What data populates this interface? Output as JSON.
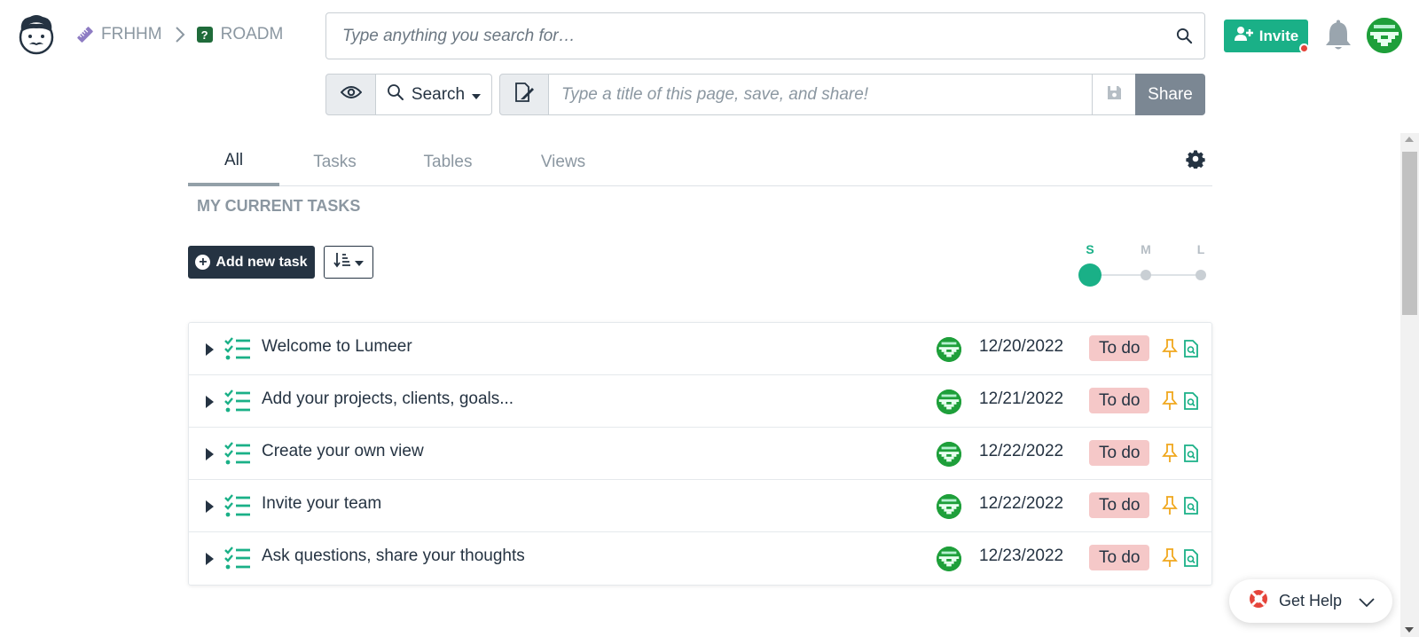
{
  "breadcrumb": {
    "workspace": {
      "label": "FRHHM",
      "icon": "ruler-icon",
      "color": "#8e7cc3"
    },
    "project": {
      "label": "ROADM",
      "icon": "question-icon",
      "color": "#1f6b3a"
    }
  },
  "search": {
    "placeholder": "Type anything you search for…"
  },
  "header": {
    "invite_label": "Invite",
    "notifications_icon": "bell-icon"
  },
  "toolbar": {
    "search_dropdown_label": "Search",
    "title_placeholder": "Type a title of this page, save, and share!",
    "share_label": "Share"
  },
  "tabs": [
    {
      "label": "All",
      "active": true
    },
    {
      "label": "Tasks",
      "active": false
    },
    {
      "label": "Tables",
      "active": false
    },
    {
      "label": "Views",
      "active": false
    }
  ],
  "section_title": "MY CURRENT TASKS",
  "add_task_label": "Add new task",
  "size_selector": {
    "options": [
      "S",
      "M",
      "L"
    ],
    "selected": "S"
  },
  "tasks": [
    {
      "title": "Welcome to Lumeer",
      "date": "12/20/2022",
      "state": "To do"
    },
    {
      "title": "Add your projects, clients, goals...",
      "date": "12/21/2022",
      "state": "To do"
    },
    {
      "title": "Create your own view",
      "date": "12/22/2022",
      "state": "To do"
    },
    {
      "title": "Invite your team",
      "date": "12/22/2022",
      "state": "To do"
    },
    {
      "title": "Ask questions, share your thoughts",
      "date": "12/23/2022",
      "state": "To do"
    }
  ],
  "help": {
    "label": "Get Help"
  },
  "colors": {
    "accent": "#1ab087",
    "dark": "#253342",
    "state_todo": "#f5c8c8",
    "pin": "#f0a81e"
  }
}
